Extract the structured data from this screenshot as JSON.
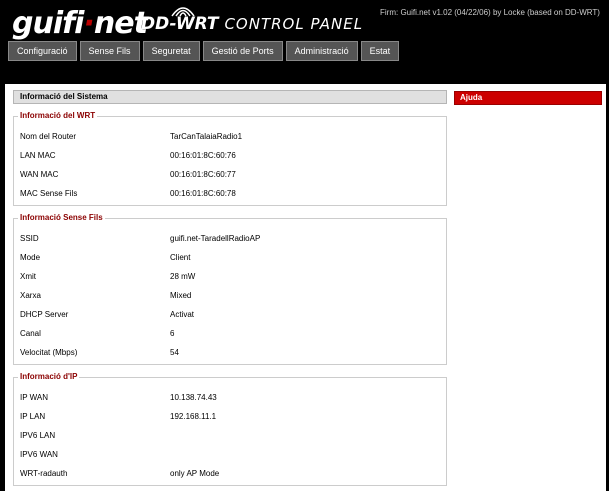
{
  "header": {
    "logo_text": "guifi",
    "logo_dot": "·",
    "logo_suffix": "net",
    "title_bold": "DD-WRT",
    "title_thin": "CONTROL PANEL",
    "firmware": "Firm: Guifi.net v1.02 (04/22/06) by Locke (based on DD-WRT)"
  },
  "tabs": [
    "Configuració",
    "Sense Fils",
    "Seguretat",
    "Gestió de Ports",
    "Administració",
    "Estat"
  ],
  "section_title": "Informació del Sistema",
  "help_title": "Ajuda",
  "wrt": {
    "legend": "Informació del WRT",
    "rows": [
      {
        "label": "Nom del Router",
        "value": "TarCanTalaiaRadio1"
      },
      {
        "label": "LAN MAC",
        "value": "00:16:01:8C:60:76"
      },
      {
        "label": "WAN MAC",
        "value": "00:16:01:8C:60:77"
      },
      {
        "label": "MAC Sense Fils",
        "value": "00:16:01:8C:60:78"
      }
    ]
  },
  "wireless": {
    "legend": "Informació Sense Fils",
    "rows": [
      {
        "label": "SSID",
        "value": "guifi.net-TaradellRadioAP"
      },
      {
        "label": "Mode",
        "value": "Client"
      },
      {
        "label": "Xmit",
        "value": "28 mW"
      },
      {
        "label": "Xarxa",
        "value": "Mixed"
      },
      {
        "label": "DHCP Server",
        "value": "Activat"
      },
      {
        "label": "Canal",
        "value": "6"
      },
      {
        "label": "Velocitat (Mbps)",
        "value": "54"
      }
    ]
  },
  "ip": {
    "legend": "Informació d'IP",
    "rows": [
      {
        "label": "IP WAN",
        "value": "10.138.74.43"
      },
      {
        "label": "IP LAN",
        "value": "192.168.11.1"
      },
      {
        "label": "IPV6 LAN",
        "value": ""
      },
      {
        "label": "IPV6 WAN",
        "value": ""
      },
      {
        "label": "WRT-radauth",
        "value": "only AP Mode"
      }
    ]
  },
  "colors": {
    "accent": "#c00000",
    "legend": "#8b0000",
    "tab_bg": "#555555"
  }
}
